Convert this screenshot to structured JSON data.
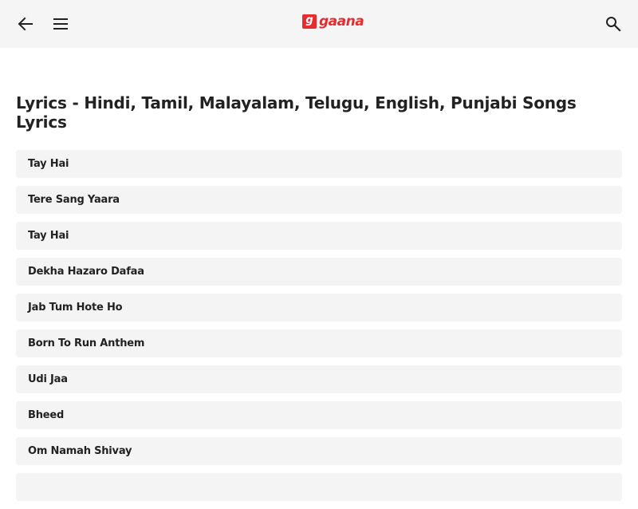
{
  "header": {
    "back_icon": "arrow-left-icon",
    "menu_icon": "hamburger-menu-icon",
    "search_icon": "search-icon",
    "logo_badge": "g",
    "logo_text": "gaana",
    "brand_color": "#e72c30"
  },
  "main": {
    "title": "Lyrics - Hindi, Tamil, Malayalam, Telugu, English, Punjabi Songs Lyrics",
    "songs": [
      {
        "title": "Tay Hai"
      },
      {
        "title": "Tere Sang Yaara"
      },
      {
        "title": "Tay Hai"
      },
      {
        "title": "Dekha Hazaro Dafaa"
      },
      {
        "title": "Jab Tum Hote Ho"
      },
      {
        "title": "Born To Run Anthem"
      },
      {
        "title": "Udi Jaa"
      },
      {
        "title": "Bheed"
      },
      {
        "title": "Om Namah Shivay"
      },
      {
        "title": ""
      }
    ]
  }
}
